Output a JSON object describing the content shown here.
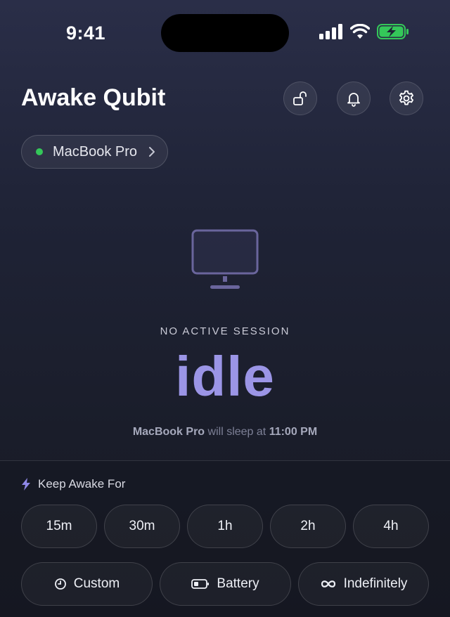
{
  "status_bar": {
    "time": "9:41",
    "icons": [
      "cellular-signal-icon",
      "wifi-icon",
      "battery-charging-icon"
    ],
    "battery_color": "#34c759"
  },
  "header": {
    "title": "Awake Qubit",
    "buttons": [
      "lock-open-icon",
      "bell-icon",
      "gear-icon"
    ]
  },
  "device": {
    "name": "MacBook Pro",
    "status_color": "#34c759"
  },
  "session": {
    "label": "NO ACTIVE SESSION",
    "state": "idle",
    "state_color": "#9b95e6",
    "sleep_device": "MacBook Pro",
    "sleep_text": "will sleep at",
    "sleep_time": "11:00 PM"
  },
  "keep_awake": {
    "label": "Keep Awake For",
    "durations": [
      "15m",
      "30m",
      "1h",
      "2h",
      "4h"
    ],
    "modes": {
      "custom": "Custom",
      "battery": "Battery",
      "indefinitely": "Indefinitely"
    }
  }
}
